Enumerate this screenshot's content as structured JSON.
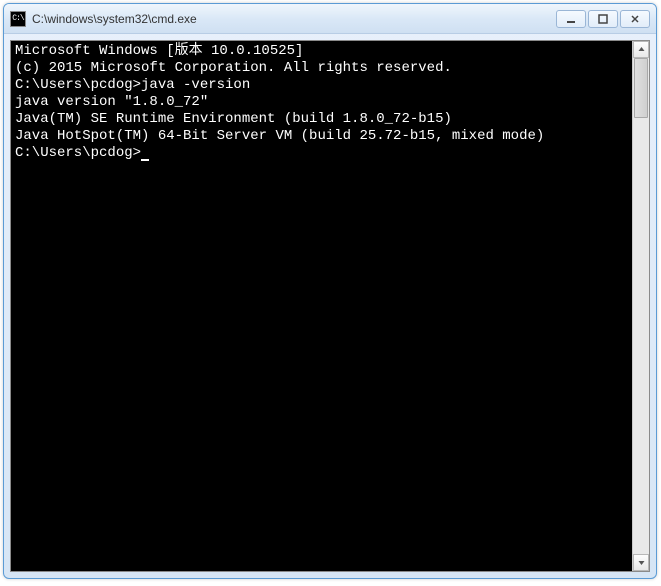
{
  "window": {
    "icon_label": "C:\\",
    "title": "C:\\windows\\system32\\cmd.exe"
  },
  "console": {
    "lines": [
      "Microsoft Windows [版本 10.0.10525]",
      "(c) 2015 Microsoft Corporation. All rights reserved.",
      "",
      "C:\\Users\\pcdog>java -version",
      "java version \"1.8.0_72\"",
      "Java(TM) SE Runtime Environment (build 1.8.0_72-b15)",
      "Java HotSpot(TM) 64-Bit Server VM (build 25.72-b15, mixed mode)",
      "",
      "C:\\Users\\pcdog>"
    ]
  }
}
